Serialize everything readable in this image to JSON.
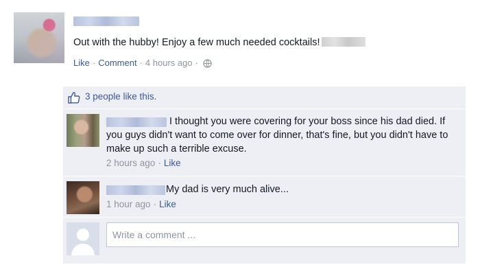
{
  "post": {
    "text": "Out with the hubby! Enjoy a few much needed cocktails!",
    "actions": {
      "like": "Like",
      "comment": "Comment",
      "time": "4 hours ago"
    },
    "audience_icon": "globe-icon"
  },
  "likes": {
    "summary": "3 people like this.",
    "icon": "thumbs-up-icon"
  },
  "comments": [
    {
      "text": "I thought you were covering for your boss since his dad died. If you guys didn't want to come over for dinner, that's fine, but you didn't have to make up such a terrible excuse.",
      "time": "2 hours ago",
      "like": "Like"
    },
    {
      "text": "My dad is very much alive...",
      "time": "1 hour ago",
      "like": "Like"
    }
  ],
  "composer": {
    "placeholder": "Write a comment ..."
  },
  "colors": {
    "link": "#3b5998",
    "panel": "#edeff4",
    "meta": "#90949c"
  }
}
